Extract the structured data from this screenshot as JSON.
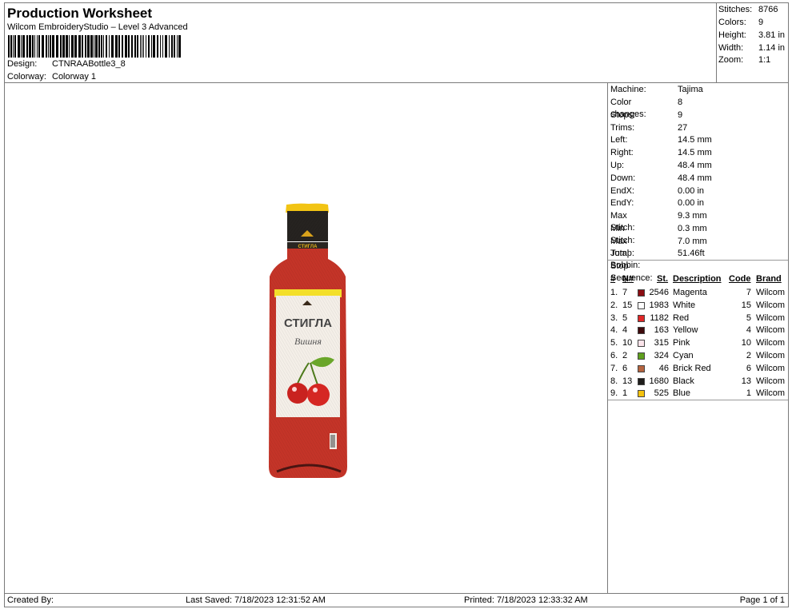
{
  "header": {
    "title": "Production Worksheet",
    "software": "Wilcom EmbroideryStudio – Level 3 Advanced",
    "design_label": "Design:",
    "design_value": "CTNRAABottle3_8",
    "colorway_label": "Colorway:",
    "colorway_value": "Colorway 1"
  },
  "stats": [
    {
      "label": "Stitches:",
      "value": "8766"
    },
    {
      "label": "Colors:",
      "value": "9"
    },
    {
      "label": "Height:",
      "value": "3.81 in"
    },
    {
      "label": "Width:",
      "value": "1.14 in"
    },
    {
      "label": "Zoom:",
      "value": "1:1"
    }
  ],
  "machine_info": [
    {
      "label": "Machine:",
      "value": "Tajima"
    },
    {
      "label": "Color changes:",
      "value": "8"
    },
    {
      "label": "Stops:",
      "value": "9"
    },
    {
      "label": "Trims:",
      "value": "27"
    },
    {
      "label": "Left:",
      "value": "14.5 mm"
    },
    {
      "label": "Right:",
      "value": "14.5 mm"
    },
    {
      "label": "Up:",
      "value": "48.4 mm"
    },
    {
      "label": "Down:",
      "value": "48.4 mm"
    },
    {
      "label": "EndX:",
      "value": "0.00 in"
    },
    {
      "label": "EndY:",
      "value": "0.00 in"
    },
    {
      "label": "Max Stitch:",
      "value": "9.3 mm"
    },
    {
      "label": "Min Stitch:",
      "value": "0.3 mm"
    },
    {
      "label": "Max Jump:",
      "value": "7.0 mm"
    },
    {
      "label": "Total Bobbin:",
      "value": "51.46ft"
    }
  ],
  "stop_sequence": {
    "title": "Stop Sequence:",
    "columns": [
      "#",
      "N#",
      "St.",
      "Description",
      "Code",
      "Brand"
    ],
    "rows": [
      {
        "idx": "1.",
        "n": "7",
        "color": "#8b0d12",
        "st": "2546",
        "desc": "Magenta",
        "code": "7",
        "brand": "Wilcom"
      },
      {
        "idx": "2.",
        "n": "15",
        "color": "#ffffff",
        "st": "1983",
        "desc": "White",
        "code": "15",
        "brand": "Wilcom"
      },
      {
        "idx": "3.",
        "n": "5",
        "color": "#e02727",
        "st": "1182",
        "desc": "Red",
        "code": "5",
        "brand": "Wilcom"
      },
      {
        "idx": "4.",
        "n": "4",
        "color": "#3e0a0c",
        "st": "163",
        "desc": "Yellow",
        "code": "4",
        "brand": "Wilcom"
      },
      {
        "idx": "5.",
        "n": "10",
        "color": "#fbe4ea",
        "st": "315",
        "desc": "Pink",
        "code": "10",
        "brand": "Wilcom"
      },
      {
        "idx": "6.",
        "n": "2",
        "color": "#5fa01e",
        "st": "324",
        "desc": "Cyan",
        "code": "2",
        "brand": "Wilcom"
      },
      {
        "idx": "7.",
        "n": "6",
        "color": "#b5643f",
        "st": "46",
        "desc": "Brick Red",
        "code": "6",
        "brand": "Wilcom"
      },
      {
        "idx": "8.",
        "n": "13",
        "color": "#1f1d1b",
        "st": "1680",
        "desc": "Black",
        "code": "13",
        "brand": "Wilcom"
      },
      {
        "idx": "9.",
        "n": "1",
        "color": "#f4c20d",
        "st": "525",
        "desc": "Blue",
        "code": "1",
        "brand": "Wilcom"
      }
    ]
  },
  "artwork": {
    "brand_text": "СТИГЛА",
    "script_text": "Вишня",
    "neck_text": "СТИГЛА"
  },
  "footer": {
    "created_by": "Created By:",
    "last_saved": "Last Saved: 7/18/2023 12:31:52 AM",
    "printed": "Printed: 7/18/2023 12:33:32 AM",
    "page": "Page 1 of 1"
  }
}
